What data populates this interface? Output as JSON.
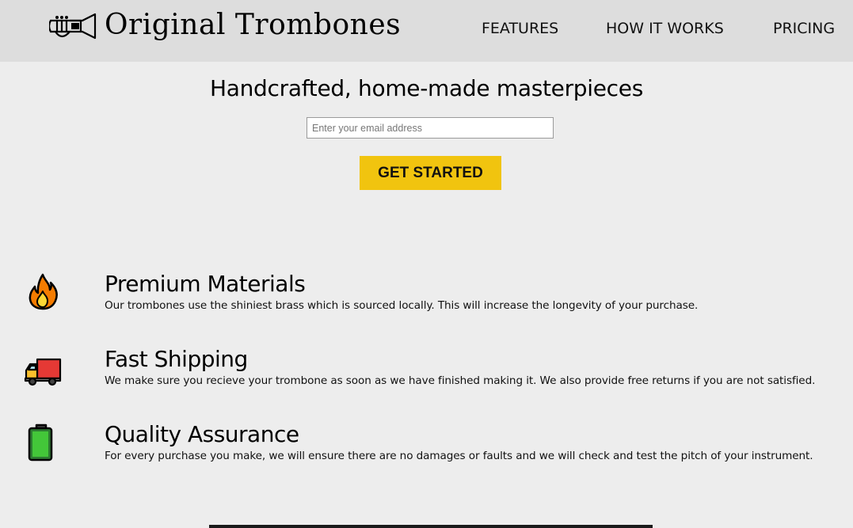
{
  "header": {
    "logo_text": "Original Trombones",
    "logo_icon": "trombone-logo-icon",
    "nav": [
      {
        "label": "FEATURES"
      },
      {
        "label": "HOW IT WORKS"
      },
      {
        "label": "PRICING"
      }
    ]
  },
  "hero": {
    "title": "Handcrafted, home-made masterpieces",
    "email_placeholder": "Enter your email address",
    "email_value": "",
    "cta_label": "GET STARTED"
  },
  "features": [
    {
      "icon": "fire-icon",
      "title": "Premium Materials",
      "description": "Our trombones use the shiniest brass which is sourced locally. This will increase the longevity of your purchase."
    },
    {
      "icon": "delivery-truck-icon",
      "title": "Fast Shipping",
      "description": "We make sure you recieve your trombone as soon as we have finished making it. We also provide free returns if you are not satisfied."
    },
    {
      "icon": "battery-icon",
      "title": "Quality Assurance",
      "description": "For every purchase you make, we will ensure there are no damages or faults and we will check and test the pitch of your instrument."
    }
  ],
  "colors": {
    "header_bg": "#dddddd",
    "page_bg": "#ededed",
    "cta_bg": "#f1c40f"
  }
}
